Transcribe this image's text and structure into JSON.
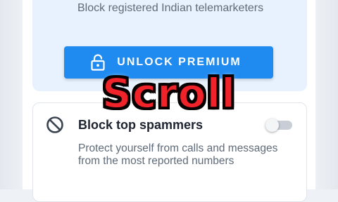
{
  "premium": {
    "description": "Block registered Indian telemarketers",
    "unlock_label": "UNLOCK PREMIUM"
  },
  "overlay": {
    "caption": "Scroll"
  },
  "spam_setting": {
    "title": "Block top spammers",
    "description": "Protect yourself from calls and messages from the most reported numbers",
    "enabled": false
  },
  "colors": {
    "accent": "#1f8bf0",
    "premium_card_bg": "#e8f2fe",
    "caption": "#f0232a"
  },
  "icons": {
    "unlock": "lock-open-icon",
    "block": "block-icon"
  }
}
